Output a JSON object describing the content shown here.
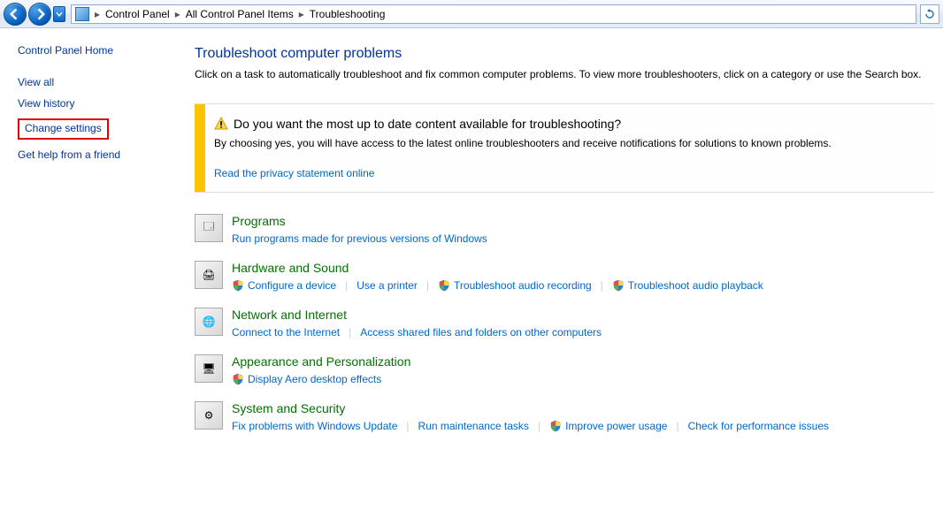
{
  "breadcrumb": {
    "items": [
      "Control Panel",
      "All Control Panel Items",
      "Troubleshooting"
    ]
  },
  "sidebar": {
    "home": "Control Panel Home",
    "links": [
      "View all",
      "View history",
      "Change settings",
      "Get help from a friend"
    ],
    "highlighted_index": 2
  },
  "main": {
    "title": "Troubleshoot computer problems",
    "subtitle": "Click on a task to automatically troubleshoot and fix common computer problems. To view more troubleshooters, click on a category or use the Search box."
  },
  "notice": {
    "question": "Do you want the most up to date content available for troubleshooting?",
    "description": "By choosing yes, you will have access to the latest online troubleshooters and receive notifications for solutions to known problems.",
    "link": "Read the privacy statement online"
  },
  "categories": [
    {
      "title": "Programs",
      "icon": "🗔",
      "links": [
        {
          "label": "Run programs made for previous versions of Windows",
          "shield": false
        }
      ]
    },
    {
      "title": "Hardware and Sound",
      "icon": "🖨",
      "links": [
        {
          "label": "Configure a device",
          "shield": true
        },
        {
          "label": "Use a printer",
          "shield": false
        },
        {
          "label": "Troubleshoot audio recording",
          "shield": true
        },
        {
          "label": "Troubleshoot audio playback",
          "shield": true
        }
      ]
    },
    {
      "title": "Network and Internet",
      "icon": "🌐",
      "links": [
        {
          "label": "Connect to the Internet",
          "shield": false
        },
        {
          "label": "Access shared files and folders on other computers",
          "shield": false
        }
      ]
    },
    {
      "title": "Appearance and Personalization",
      "icon": "🖥",
      "links": [
        {
          "label": "Display Aero desktop effects",
          "shield": true
        }
      ]
    },
    {
      "title": "System and Security",
      "icon": "⚙",
      "links": [
        {
          "label": "Fix problems with Windows Update",
          "shield": false
        },
        {
          "label": "Run maintenance tasks",
          "shield": false
        },
        {
          "label": "Improve power usage",
          "shield": true
        },
        {
          "label": "Check for performance issues",
          "shield": false
        }
      ]
    }
  ]
}
